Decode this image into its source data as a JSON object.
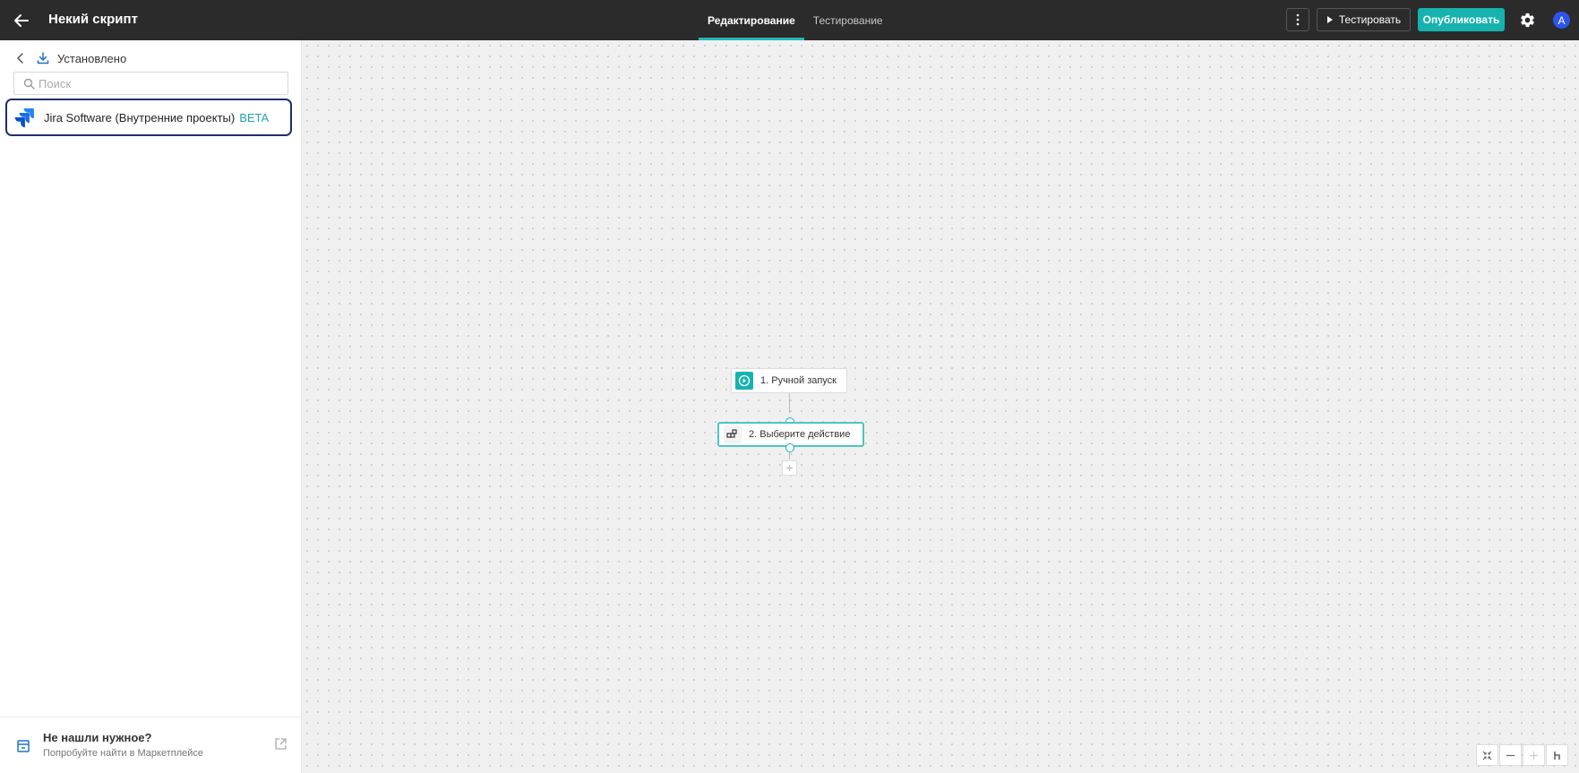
{
  "header": {
    "title": "Некий скрипт",
    "tabs": [
      {
        "label": "Редактирование",
        "active": true
      },
      {
        "label": "Тестирование",
        "active": false
      }
    ],
    "test_label": "Тестировать",
    "publish_label": "Опубликовать",
    "avatar_initial": "A"
  },
  "sidebar": {
    "section_title": "Установлено",
    "search_placeholder": "Поиск",
    "search_value": "",
    "apps": [
      {
        "label": "Jira Software (Внутренние проекты)",
        "badge": "BETA",
        "icon": "jira-icon"
      }
    ],
    "footer": {
      "title": "Не нашли нужное?",
      "subtitle": "Попробуйте найти в Маркетплейсе"
    }
  },
  "canvas": {
    "nodes": [
      {
        "label": "1. Ручной запуск",
        "icon": "play-circle-icon"
      },
      {
        "label": "2. Выберите действие",
        "icon": "blocks-icon"
      }
    ]
  },
  "colors": {
    "accent": "#16b3ae",
    "topbar": "#2b2b2b",
    "selection_border": "#1d2f6f",
    "avatar": "#2f54eb"
  }
}
